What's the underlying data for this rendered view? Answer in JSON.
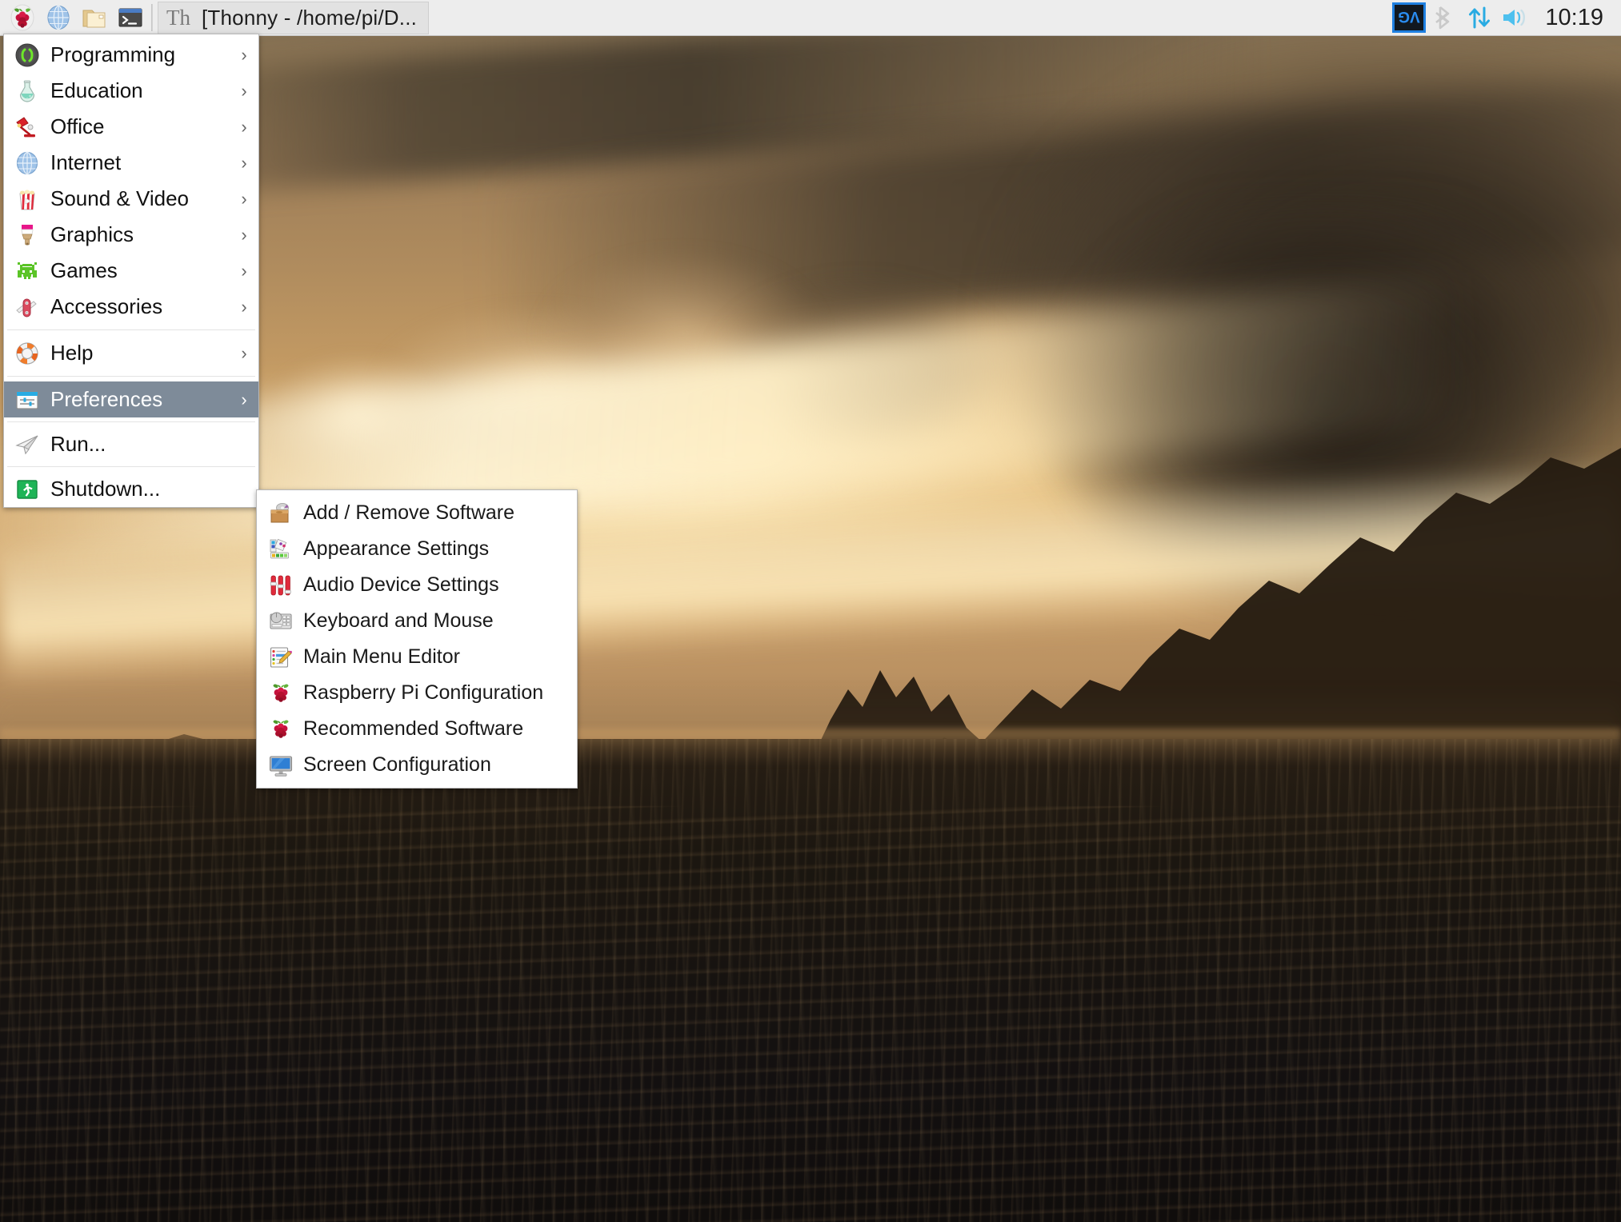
{
  "taskbar": {
    "launchers": [
      {
        "name": "raspberry-menu-icon",
        "label": "Menu"
      },
      {
        "name": "web-browser-icon",
        "label": "Web Browser"
      },
      {
        "name": "file-manager-icon",
        "label": "File Manager"
      },
      {
        "name": "terminal-icon",
        "label": "Terminal"
      }
    ],
    "task_window": {
      "icon": "thonny-icon",
      "icon_text": "Th",
      "title": "[Thonny  -  /home/pi/D..."
    },
    "tray": {
      "vnc_label": "VNC",
      "bluetooth": "bluetooth-icon",
      "network": "network-updown-icon",
      "volume": "volume-icon"
    },
    "clock": "10:19"
  },
  "main_menu": {
    "items": [
      {
        "label": "Programming",
        "icon": "programming-braces-icon",
        "arrow": "›",
        "selected": false
      },
      {
        "label": "Education",
        "icon": "education-flask-icon",
        "arrow": "›",
        "selected": false
      },
      {
        "label": "Office",
        "icon": "office-lamp-icon",
        "arrow": "›",
        "selected": false
      },
      {
        "label": "Internet",
        "icon": "internet-globe-icon",
        "arrow": "›",
        "selected": false
      },
      {
        "label": "Sound & Video",
        "icon": "sound-video-popcorn-icon",
        "arrow": "›",
        "selected": false
      },
      {
        "label": "Graphics",
        "icon": "graphics-brush-icon",
        "arrow": "›",
        "selected": false
      },
      {
        "label": "Games",
        "icon": "games-invader-icon",
        "arrow": "›",
        "selected": false
      },
      {
        "label": "Accessories",
        "icon": "accessories-knife-icon",
        "arrow": "›",
        "selected": false
      },
      {
        "label": "Help",
        "icon": "help-lifering-icon",
        "arrow": "›",
        "selected": false
      },
      {
        "label": "Preferences",
        "icon": "preferences-sliders-icon",
        "arrow": "›",
        "selected": true
      },
      {
        "label": "Run...",
        "icon": "run-paperplane-icon",
        "arrow": "",
        "selected": false
      },
      {
        "label": "Shutdown...",
        "icon": "shutdown-exit-icon",
        "arrow": "",
        "selected": false
      }
    ]
  },
  "preferences_submenu": {
    "items": [
      {
        "label": "Add / Remove Software",
        "icon": "add-remove-software-icon"
      },
      {
        "label": "Appearance Settings",
        "icon": "appearance-settings-icon"
      },
      {
        "label": "Audio Device Settings",
        "icon": "audio-device-settings-icon"
      },
      {
        "label": "Keyboard and Mouse",
        "icon": "keyboard-mouse-icon"
      },
      {
        "label": "Main Menu Editor",
        "icon": "main-menu-editor-icon"
      },
      {
        "label": "Raspberry Pi Configuration",
        "icon": "raspberry-pi-config-icon"
      },
      {
        "label": "Recommended Software",
        "icon": "recommended-software-icon"
      },
      {
        "label": "Screen Configuration",
        "icon": "screen-configuration-icon"
      }
    ]
  },
  "colors": {
    "taskbar_bg": "#ededed",
    "menu_bg": "#ffffff",
    "menu_selected_bg": "#7e8b99",
    "menu_selected_text": "#ffffff",
    "menu_text": "#111111",
    "accent_blue": "#1e7fe0",
    "wallpaper_sky": "#cfa468",
    "wallpaper_sea": "#171310"
  },
  "desktop": {
    "wallpaper_name": "sunset-over-sea-and-mountains"
  }
}
